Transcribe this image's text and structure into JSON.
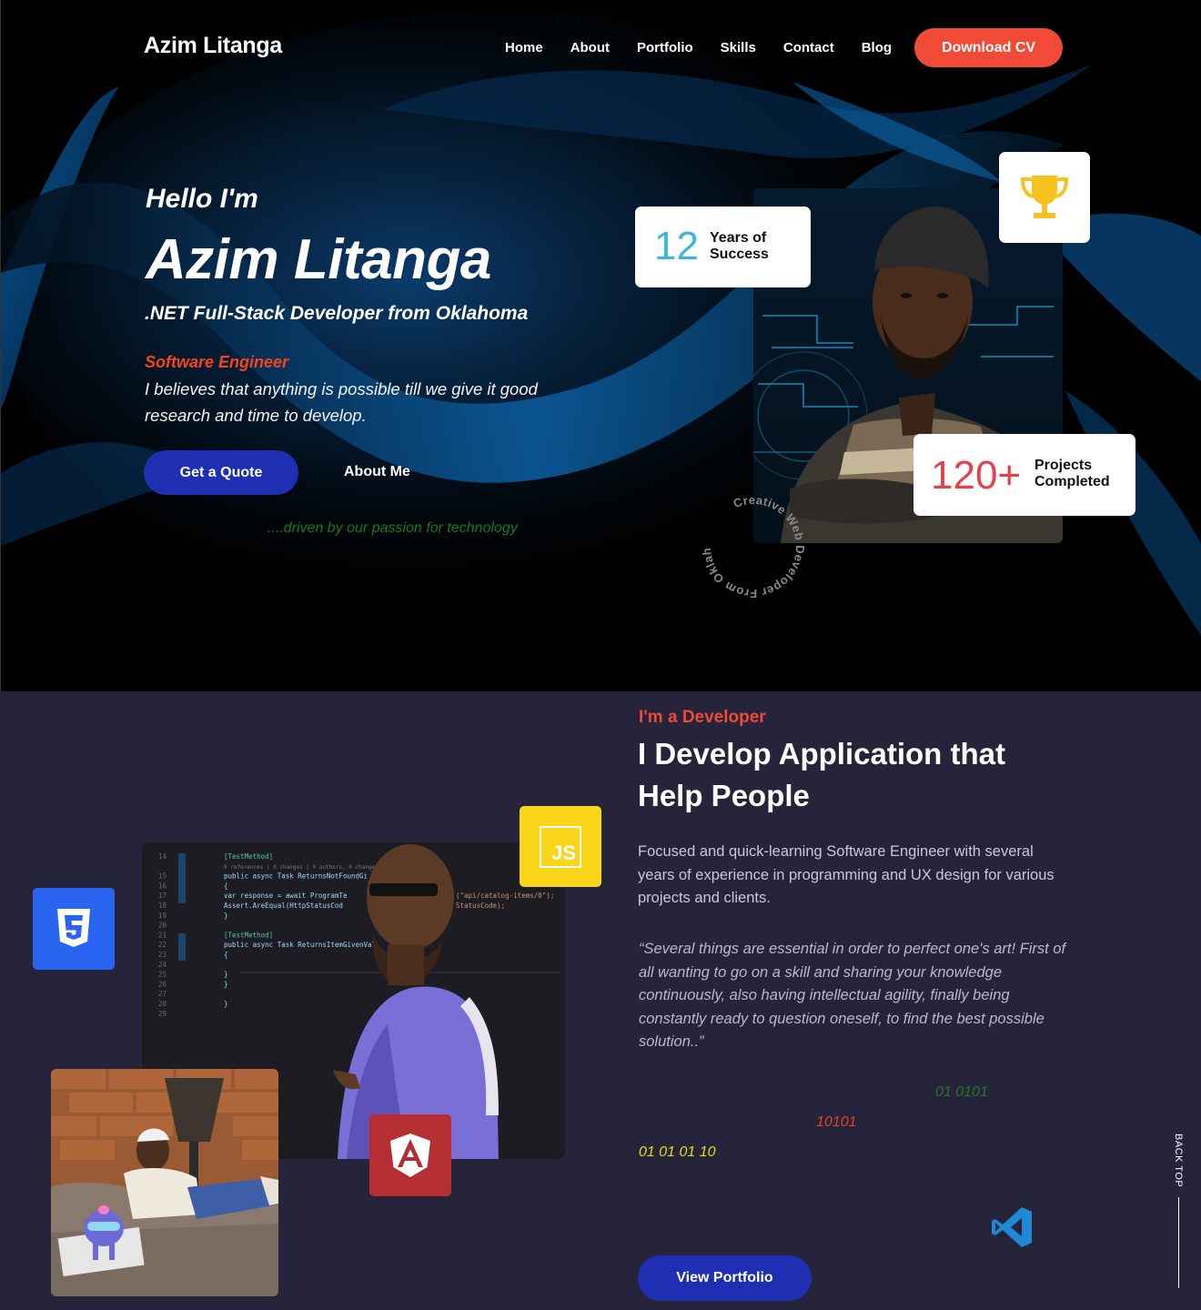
{
  "nav": {
    "brand": "Azim Litanga",
    "links": [
      "Home",
      "About",
      "Portfolio",
      "Skills",
      "Contact",
      "Blog"
    ],
    "cta": "Download CV"
  },
  "hero": {
    "greeting": "Hello I'm",
    "name": "Azim Litanga",
    "tagline": ".NET Full-Stack Developer from Oklahoma",
    "role": "Software Engineer",
    "belief": "I believes that anything is possible till we give it good research and time to develop.",
    "primary_button": "Get a Quote",
    "secondary_button": "About Me",
    "motto": "....driven by our passion for technology",
    "stats": {
      "years_value": "12",
      "years_label": "Years of Success",
      "projects_value": "120+",
      "projects_label": "Projects Completed"
    },
    "circle_text": "Creative Web Developer From Oklahoma",
    "trophy_icon": "trophy-icon"
  },
  "about": {
    "eyebrow": "I'm a Developer",
    "headline": "I Develop Application that Help People",
    "description": "Focused and quick-learning Software Engineer with several years of experience in programming and UX design for various projects and clients.",
    "quote": "“Several things are essential in order to perfect one's art! First of all wanting to go on a skill and sharing your knowledge continuously, also having intellectual agility, finally being constantly ready to question oneself, to find the best possible solution..”",
    "binary": [
      "01 0101",
      "10101",
      "01 01 01 10"
    ],
    "button": "View Portfolio",
    "back_top": "BACK TOP",
    "badges": {
      "css": "css3-icon",
      "js": "JS",
      "angular": "angular-icon",
      "vscode": "vscode-icon"
    },
    "code_lines": [
      {
        "n": "14",
        "t": "[TestMethod]"
      },
      {
        "n": "",
        "t": "0 references | 0 changes | 0 authors, 0 changes"
      },
      {
        "n": "15",
        "t": "public async Task ReturnsNotFoundGi"
      },
      {
        "n": "16",
        "t": "{"
      },
      {
        "n": "17",
        "t": "    var response = await ProgramTe"
      },
      {
        "n": "18",
        "t": "    Assert.AreEqual(HttpStatusCod"
      },
      {
        "n": "19",
        "t": "}"
      },
      {
        "n": "20",
        "t": ""
      },
      {
        "n": "21",
        "t": "[TestMethod]"
      },
      {
        "n": "22",
        "t": "public async Task ReturnsItemGivenVal"
      },
      {
        "n": "23",
        "t": "{"
      },
      {
        "n": "24",
        "t": ""
      },
      {
        "n": "25",
        "t": "}"
      },
      {
        "n": "26",
        "t": "}"
      },
      {
        "n": "27",
        "t": ""
      },
      {
        "n": "28",
        "t": "}"
      },
      {
        "n": "29",
        "t": ""
      }
    ],
    "code_fragments": [
      "(\"api/catalog-items/0\");",
      "StatusCode);"
    ]
  },
  "colors": {
    "accent": "#f14a36",
    "primary_button": "#1f2fb3",
    "years": "#3ab7d9",
    "projects": "#e8404a"
  }
}
